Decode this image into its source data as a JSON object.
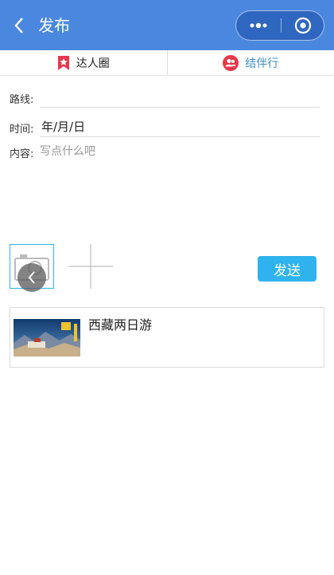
{
  "nav": {
    "title": "发布",
    "back_icon": "chevron-left-icon",
    "more_icon": "more-dots-icon",
    "close_icon": "target-circle-icon",
    "bg_color": "#4a88df"
  },
  "tabs": [
    {
      "label": "达人圈",
      "icon": "star-bookmark-icon",
      "icon_color": "#e8374a"
    },
    {
      "label": "结伴行",
      "icon": "people-icon",
      "icon_color": "#e8374a",
      "label_color": "#3f8fc9"
    }
  ],
  "form": {
    "route_label": "路线:",
    "route_value": "",
    "time_label": "时间:",
    "time_value": "年/月/日",
    "content_label": "内容:",
    "content_placeholder": "写点什么吧"
  },
  "media": {
    "camera_icon": "camera-icon",
    "add_icon": "plus-icon",
    "back_icon": "chevron-left-icon"
  },
  "send_label": "发送",
  "send_color": "#2eb3ee",
  "card": {
    "title": "西藏两日游",
    "thumb_icon": "tibet-poster-thumbnail"
  }
}
